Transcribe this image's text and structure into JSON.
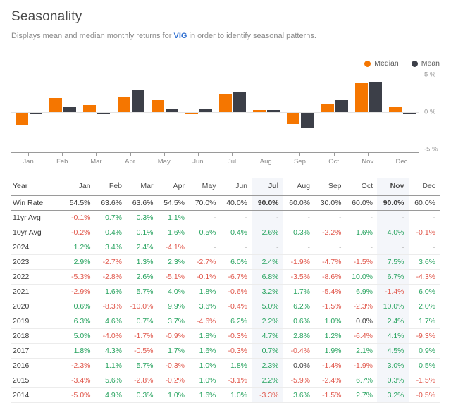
{
  "header": {
    "title": "Seasonality",
    "subtitle_before": "Displays mean and median monthly returns for ",
    "ticker": "VIG",
    "subtitle_after": " in order to identify seasonal patterns."
  },
  "legend": {
    "median_label": "Median",
    "mean_label": "Mean",
    "median_color": "#f57600",
    "mean_color": "#3c3f48"
  },
  "chart_data": {
    "type": "bar",
    "title": "Seasonality",
    "xlabel": "",
    "ylabel": "%",
    "ylim": [
      -5,
      5
    ],
    "ytick_labels": [
      "5 %",
      "0 %",
      "-5 %"
    ],
    "ytick_values": [
      5,
      0,
      -5
    ],
    "grid": true,
    "legend_position": "top-right",
    "categories": [
      "Jan",
      "Feb",
      "Mar",
      "Apr",
      "May",
      "Jun",
      "Jul",
      "Aug",
      "Sep",
      "Oct",
      "Nov",
      "Dec"
    ],
    "series": [
      {
        "name": "Median",
        "color": "#f57600",
        "values": [
          -1.7,
          1.9,
          0.9,
          2.0,
          1.6,
          -0.3,
          2.4,
          0.3,
          -1.6,
          1.1,
          3.9,
          0.7
        ]
      },
      {
        "name": "Mean",
        "color": "#3c3f48",
        "values": [
          -0.2,
          0.7,
          -0.2,
          2.9,
          0.5,
          0.4,
          2.6,
          0.3,
          -2.2,
          1.6,
          4.0,
          -0.1
        ]
      }
    ]
  },
  "table": {
    "columns": [
      "Year",
      "Jan",
      "Feb",
      "Mar",
      "Apr",
      "May",
      "Jun",
      "Jul",
      "Aug",
      "Sep",
      "Oct",
      "Nov",
      "Dec"
    ],
    "highlighted_columns": [
      "Jul",
      "Nov"
    ],
    "rows": [
      {
        "label": "Win Rate",
        "type": "winrate",
        "values": [
          "54.5%",
          "63.6%",
          "63.6%",
          "54.5%",
          "70.0%",
          "40.0%",
          "90.0%",
          "60.0%",
          "30.0%",
          "60.0%",
          "90.0%",
          "60.0%"
        ]
      },
      {
        "label": "11yr Avg",
        "type": "avg",
        "values": [
          "-0.1%",
          "0.7%",
          "0.3%",
          "1.1%",
          "-",
          "-",
          "-",
          "-",
          "-",
          "-",
          "-",
          "-"
        ]
      },
      {
        "label": "10yr Avg",
        "type": "avg",
        "values": [
          "-0.2%",
          "0.4%",
          "0.1%",
          "1.6%",
          "0.5%",
          "0.4%",
          "2.6%",
          "0.3%",
          "-2.2%",
          "1.6%",
          "4.0%",
          "-0.1%"
        ]
      },
      {
        "label": "2024",
        "type": "year",
        "values": [
          "1.2%",
          "3.4%",
          "2.4%",
          "-4.1%",
          "-",
          "-",
          "-",
          "-",
          "-",
          "-",
          "-",
          "-"
        ]
      },
      {
        "label": "2023",
        "type": "year",
        "values": [
          "2.9%",
          "-2.7%",
          "1.3%",
          "2.3%",
          "-2.7%",
          "6.0%",
          "2.4%",
          "-1.9%",
          "-4.7%",
          "-1.5%",
          "7.5%",
          "3.6%"
        ]
      },
      {
        "label": "2022",
        "type": "year",
        "values": [
          "-5.3%",
          "-2.8%",
          "2.6%",
          "-5.1%",
          "-0.1%",
          "-6.7%",
          "6.8%",
          "-3.5%",
          "-8.6%",
          "10.0%",
          "6.7%",
          "-4.3%"
        ]
      },
      {
        "label": "2021",
        "type": "year",
        "values": [
          "-2.9%",
          "1.6%",
          "5.7%",
          "4.0%",
          "1.8%",
          "-0.6%",
          "3.2%",
          "1.7%",
          "-5.4%",
          "6.9%",
          "-1.4%",
          "6.0%"
        ]
      },
      {
        "label": "2020",
        "type": "year",
        "values": [
          "0.6%",
          "-8.3%",
          "-10.0%",
          "9.9%",
          "3.6%",
          "-0.4%",
          "5.0%",
          "6.2%",
          "-1.5%",
          "-2.3%",
          "10.0%",
          "2.0%"
        ]
      },
      {
        "label": "2019",
        "type": "year",
        "values": [
          "6.3%",
          "4.6%",
          "0.7%",
          "3.7%",
          "-4.6%",
          "6.2%",
          "2.2%",
          "0.6%",
          "1.0%",
          "0.0%",
          "2.4%",
          "1.7%"
        ]
      },
      {
        "label": "2018",
        "type": "year",
        "values": [
          "5.0%",
          "-4.0%",
          "-1.7%",
          "-0.9%",
          "1.8%",
          "-0.3%",
          "4.7%",
          "2.8%",
          "1.2%",
          "-6.4%",
          "4.1%",
          "-9.3%"
        ]
      },
      {
        "label": "2017",
        "type": "year",
        "values": [
          "1.8%",
          "4.3%",
          "-0.5%",
          "1.7%",
          "1.6%",
          "-0.3%",
          "0.7%",
          "-0.4%",
          "1.9%",
          "2.1%",
          "4.5%",
          "0.9%"
        ]
      },
      {
        "label": "2016",
        "type": "year",
        "values": [
          "-2.3%",
          "1.1%",
          "5.7%",
          "-0.3%",
          "1.0%",
          "1.8%",
          "2.3%",
          "0.0%",
          "-1.4%",
          "-1.9%",
          "3.0%",
          "0.5%"
        ]
      },
      {
        "label": "2015",
        "type": "year",
        "values": [
          "-3.4%",
          "5.6%",
          "-2.8%",
          "-0.2%",
          "1.0%",
          "-3.1%",
          "2.2%",
          "-5.9%",
          "-2.4%",
          "6.7%",
          "0.3%",
          "-1.5%"
        ]
      },
      {
        "label": "2014",
        "type": "year",
        "values": [
          "-5.0%",
          "4.9%",
          "0.3%",
          "1.0%",
          "1.6%",
          "1.0%",
          "-3.3%",
          "3.6%",
          "-1.5%",
          "2.7%",
          "3.2%",
          "-0.5%"
        ]
      }
    ]
  }
}
